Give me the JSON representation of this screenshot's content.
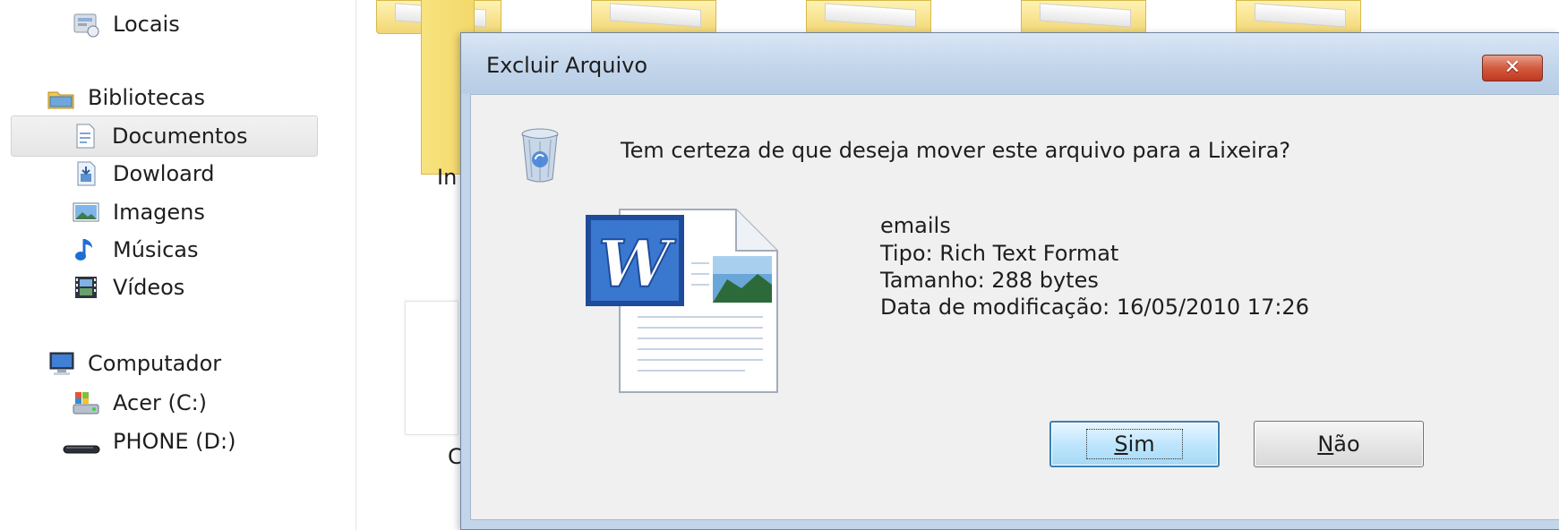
{
  "sidebar": {
    "items": [
      {
        "label": "Locais",
        "icon": "recent-places-icon"
      },
      {
        "label": "Bibliotecas",
        "icon": "libraries-icon"
      },
      {
        "label": "Documentos",
        "icon": "documents-icon",
        "selected": true
      },
      {
        "label": "Dowloard",
        "icon": "downloads-icon"
      },
      {
        "label": "Imagens",
        "icon": "pictures-icon"
      },
      {
        "label": "Músicas",
        "icon": "music-icon"
      },
      {
        "label": "Vídeos",
        "icon": "videos-icon"
      },
      {
        "label": "Computador",
        "icon": "computer-icon"
      },
      {
        "label": "Acer (C:)",
        "icon": "drive-c-icon"
      },
      {
        "label": "PHONE (D:)",
        "icon": "drive-d-icon"
      }
    ]
  },
  "background": {
    "partial_label_1": "In",
    "partial_label_2": "C"
  },
  "dialog": {
    "title": "Excluir Arquivo",
    "close_icon": "close-icon",
    "close_glyph": "✕",
    "question": "Tem certeza de que deseja mover este arquivo para a Lixeira?",
    "file": {
      "name": "emails",
      "type": "Tipo: Rich Text Format",
      "size": "Tamanho: 288 bytes",
      "modified": "Data de modificação: 16/05/2010 17:26",
      "icon": "word-document-icon"
    },
    "buttons": {
      "yes": "Sim",
      "no": "Não"
    }
  },
  "colors": {
    "dialog_frame": "#c2d5ea",
    "panel_bg": "#f0f0f0",
    "close_red": "#c0391f",
    "word_blue": "#2b62b8"
  }
}
